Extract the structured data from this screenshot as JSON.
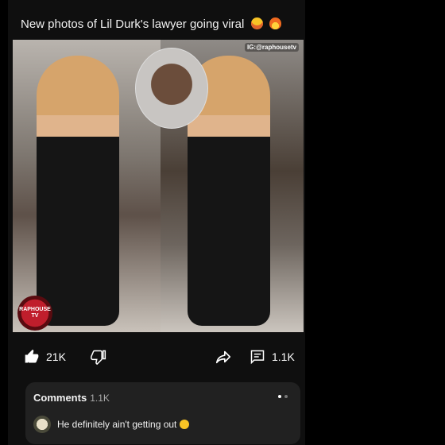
{
  "post": {
    "caption": "New photos of Lil Durk's lawyer going viral",
    "caption_emoji_1": "heart-eyes-emoji",
    "caption_emoji_2": "fire-emoji",
    "media": {
      "watermark": "IG:@raphousetv",
      "logo_text": "RAPHOUSE TV"
    }
  },
  "actions": {
    "like_count": "21K",
    "comment_count": "1.1K"
  },
  "comments": {
    "title": "Comments",
    "count": "1.1K",
    "top_comment": "He definitely ain't getting out"
  }
}
